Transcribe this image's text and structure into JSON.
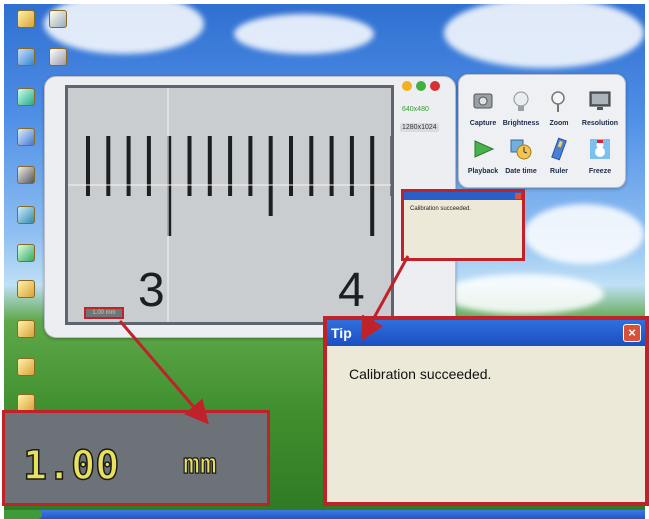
{
  "desktop": {
    "icons": [
      "",
      "",
      "",
      "",
      "",
      "",
      "",
      "",
      "",
      "",
      ""
    ]
  },
  "viewer": {
    "res_option_1": "640x480",
    "res_option_2": "1280x1024",
    "ruler": {
      "labels": [
        "3",
        "4"
      ]
    }
  },
  "toolbar": {
    "items": [
      {
        "label": "Capture",
        "icon": "camera-icon"
      },
      {
        "label": "Brightness",
        "icon": "lightbulb-icon"
      },
      {
        "label": "Zoom",
        "icon": "magnifier-icon"
      },
      {
        "label": "Resolution",
        "icon": "monitor-icon"
      },
      {
        "label": "Playback",
        "icon": "play-icon"
      },
      {
        "label": "Date time",
        "icon": "clock-icon"
      },
      {
        "label": "Ruler",
        "icon": "ruler-icon"
      },
      {
        "label": "Freeze",
        "icon": "snowman-icon"
      }
    ]
  },
  "small_tip": {
    "message": "Calibration succeeded."
  },
  "measurement": {
    "value": "1.00",
    "unit": "mm"
  },
  "tip_dialog": {
    "title": "Tip",
    "message": "Calibration succeeded.",
    "close": "×"
  },
  "colors": {
    "highlight": "#c0222a",
    "accent": "#2a5fc8",
    "readout": "#e8e25a"
  }
}
